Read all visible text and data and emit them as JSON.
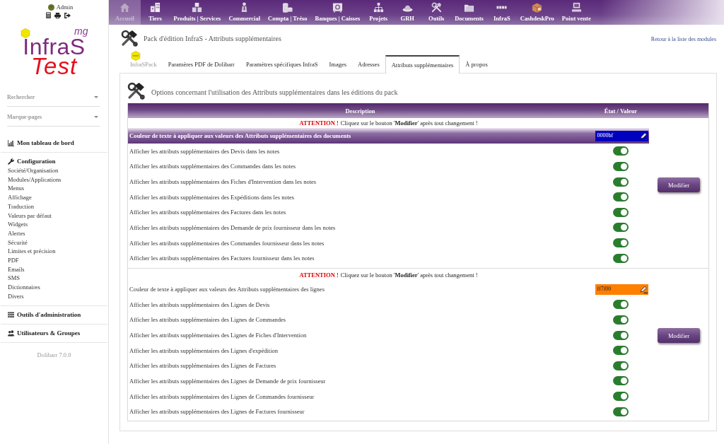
{
  "sidebar": {
    "user": "Admin",
    "logo": {
      "superscript": "mg",
      "title": "InfraS",
      "subtitle": "Test"
    },
    "selects": [
      {
        "label": "Rechercher"
      },
      {
        "label": "Marque-pages"
      }
    ],
    "menu": [
      {
        "label": "Mon tableau de bord"
      },
      {
        "label": "Configuration",
        "children": [
          {
            "label": "Société/Organisation"
          },
          {
            "label": "Modules/Applications"
          },
          {
            "label": "Menus"
          },
          {
            "label": "Affichage"
          },
          {
            "label": "Traduction"
          },
          {
            "label": "Valeurs par défaut"
          },
          {
            "label": "Widgets"
          },
          {
            "label": "Alertes"
          },
          {
            "label": "Sécurité"
          },
          {
            "label": "Limites et précision"
          },
          {
            "label": "PDF"
          },
          {
            "label": "Emails"
          },
          {
            "label": "SMS"
          },
          {
            "label": "Dictionnaires"
          },
          {
            "label": "Divers"
          }
        ]
      },
      {
        "label": "Outils d'administration"
      },
      {
        "label": "Utilisateurs & Groupes"
      }
    ],
    "version": "Dolibarr 7.0.0"
  },
  "top_menu": [
    {
      "label": "Accueil",
      "selected": true
    },
    {
      "label": "Tiers",
      "selected": false
    },
    {
      "label": "Produits | Services",
      "selected": false
    },
    {
      "label": "Commercial",
      "selected": false
    },
    {
      "label": "Compta | Tréso",
      "selected": false
    },
    {
      "label": "Banques | Caisses",
      "selected": false
    },
    {
      "label": "Projets",
      "selected": false
    },
    {
      "label": "GRH",
      "selected": false
    },
    {
      "label": "Outils",
      "selected": false
    },
    {
      "label": "Documents",
      "selected": false
    },
    {
      "label": "InfraS",
      "selected": false
    },
    {
      "label": "CashdeskPro",
      "selected": false
    },
    {
      "label": "Point vente",
      "selected": false
    }
  ],
  "page": {
    "title": "Pack d'édition InfraS - Attributs supplémentaires",
    "back_link": "Retour à la liste des modules"
  },
  "tabs": [
    {
      "label": "InfraSPack",
      "kind": "logo",
      "selected": false
    },
    {
      "label": "Paramères PDF de Dolibarr",
      "kind": "text",
      "selected": false
    },
    {
      "label": "Paramètres spécifiques InfraS",
      "kind": "text",
      "selected": false
    },
    {
      "label": "Images",
      "kind": "text",
      "selected": false
    },
    {
      "label": "Adresses",
      "kind": "text",
      "selected": false
    },
    {
      "label": "Attributs supplémentaires",
      "kind": "text",
      "selected": true
    },
    {
      "label": "À propos",
      "kind": "text",
      "selected": false
    }
  ],
  "panel": {
    "title": "Options concernant l'utilisation des Attributs supplémentaires dans les éditions du pack",
    "columns": [
      "Description",
      "État / Valeur"
    ],
    "sections": [
      {
        "warning_label": "ATTENTION !",
        "warning_text": "Cliquez sur le bouton '**Modifier**' après tout changement !",
        "color_setting": {
          "label": "Couleur de texte à appliquer aux valeurs des Attributs supplémentaires des documents",
          "value": "0000bf",
          "color": "#0000bf",
          "highlighted": true
        },
        "options": [
          {
            "label": "Afficher les attributs supplémentaires des Devis dans les notes",
            "on": true
          },
          {
            "label": "Afficher les attributs supplémentaires des Commandes dans les notes",
            "on": true
          },
          {
            "label": "Afficher les attributs supplémentaires des Fiches d'Intervention dans les notes",
            "on": true
          },
          {
            "label": "Afficher les attributs supplémentaires des Expéditions dans les notes",
            "on": true
          },
          {
            "label": "Afficher les attributs supplémentaires des Factures dans les notes",
            "on": true
          },
          {
            "label": "Afficher les attributs supplémentaires des Demande de prix fournisseur dans les notes",
            "on": true
          },
          {
            "label": "Afficher les attributs supplémentaires des Commandes fournisseur dans les notes",
            "on": true
          },
          {
            "label": "Afficher les attributs supplémentaires des Factures fournisseur dans les notes",
            "on": true
          }
        ],
        "button": "Modifier"
      },
      {
        "warning_label": "ATTENTION !",
        "warning_text": "Cliquez sur le bouton '**Modifier**' après tout changement !",
        "color_setting": {
          "label": "Couleur de texte à appliquer aux valeurs des Attributs supplémentaires des lignes",
          "value": "ff7f00",
          "color": "#ff7f00",
          "highlighted": false
        },
        "options": [
          {
            "label": "Afficher les attributs supplémentaires des Lignes de Devis",
            "on": true
          },
          {
            "label": "Afficher les attributs supplémentaires des Lignes de Commandes",
            "on": true
          },
          {
            "label": "Afficher les attributs supplémentaires des Lignes de Fiches d'Intervention",
            "on": true
          },
          {
            "label": "Afficher les attributs supplémentaires des Lignes d'expédition",
            "on": true
          },
          {
            "label": "Afficher les attributs supplémentaires des Lignes de Factures",
            "on": true
          },
          {
            "label": "Afficher les attributs supplémentaires des Lignes de Demande de prix fournisseur",
            "on": true
          },
          {
            "label": "Afficher les attributs supplémentaires des Lignes de Commandes fournisseur",
            "on": true
          },
          {
            "label": "Afficher les attributs supplémentaires des Lignes de Factures fournisseur",
            "on": true
          }
        ],
        "button": "Modifier"
      }
    ]
  }
}
